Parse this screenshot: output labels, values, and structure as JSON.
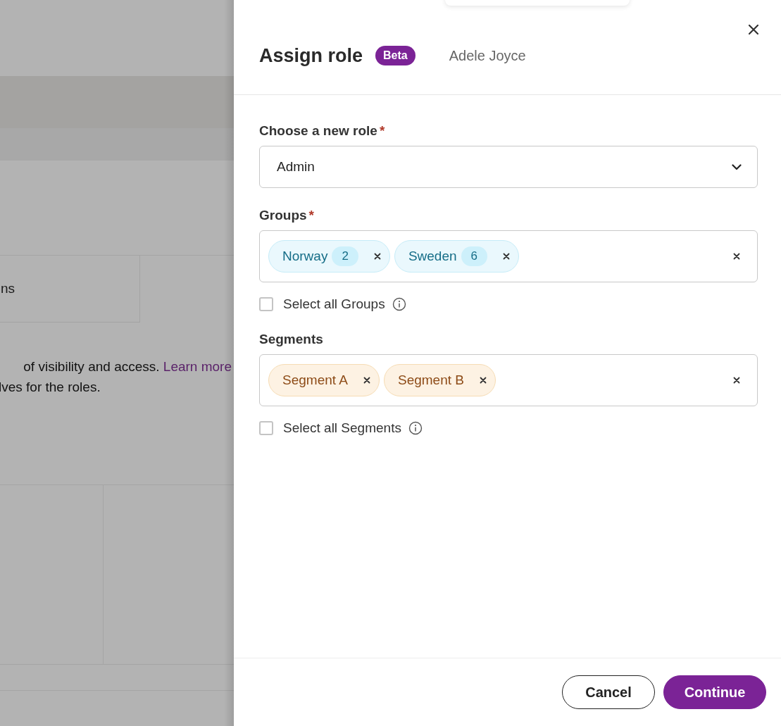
{
  "background": {
    "cell_text": "ns",
    "description": {
      "text": "of visibility and access.",
      "link": "Learn more"
    },
    "description_2": "lves for the roles."
  },
  "drawer": {
    "title": "Assign role",
    "badge": "Beta",
    "user": "Adele Joyce",
    "fields": [
      {
        "kind": "select",
        "label": "Choose a new role",
        "required_mark": "*",
        "value": "Admin"
      },
      {
        "kind": "groups",
        "label": "Groups",
        "required_mark": "*",
        "tags": [
          {
            "label": "Norway",
            "count": "2"
          },
          {
            "label": "Sweden",
            "count": "6"
          }
        ],
        "select_all": {
          "label": "Select all Groups",
          "checked": false
        }
      },
      {
        "kind": "segments",
        "label": "Segments",
        "tags": [
          {
            "label": "Segment A"
          },
          {
            "label": "Segment B"
          }
        ],
        "select_all": {
          "label": "Select all Segments",
          "checked": false
        }
      }
    ],
    "buttons": [
      {
        "label": "Cancel",
        "kind": "secondary"
      },
      {
        "label": "Continue",
        "kind": "primary"
      }
    ]
  }
}
